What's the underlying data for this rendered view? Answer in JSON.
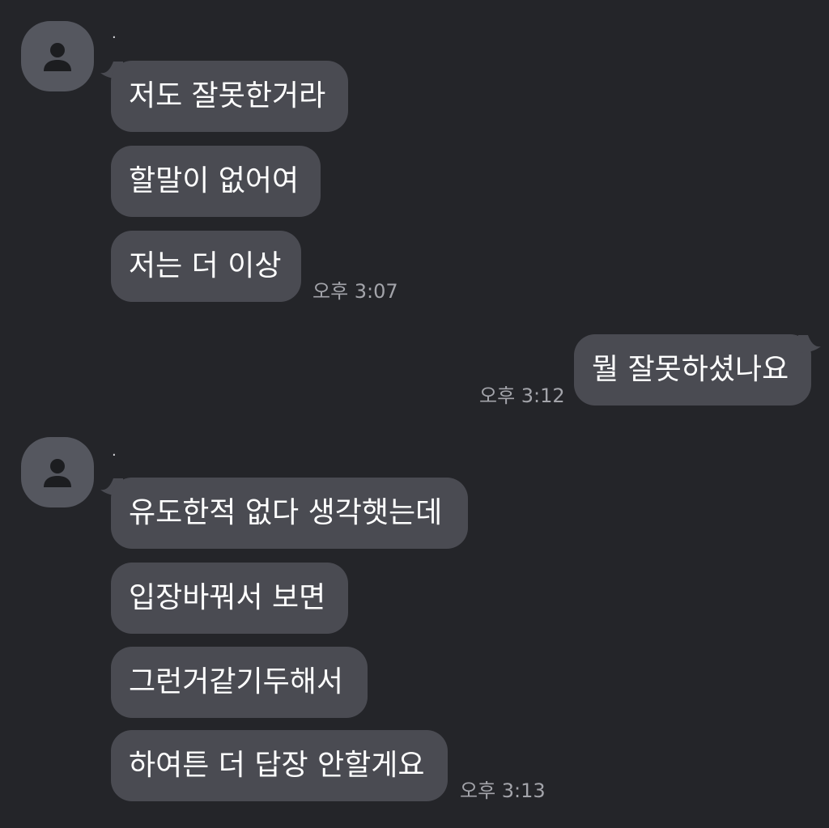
{
  "messages": {
    "group1": {
      "sender_name": "·",
      "avatar_icon": "person-icon",
      "bubbles": [
        "저도 잘못한거라",
        "할말이 없어여",
        "저는 더 이상"
      ],
      "time": "오후 3:07"
    },
    "outgoing": {
      "text": "뭘 잘못하셨나요",
      "time": "오후 3:12"
    },
    "group2": {
      "sender_name": "·",
      "avatar_icon": "person-icon",
      "bubbles": [
        "유도한적 없다 생각햇는데",
        "입장바꿔서 보면",
        "그런거같기두해서",
        "하여튼 더 답장 안할게요"
      ],
      "time": "오후 3:13"
    }
  },
  "colors": {
    "background": "#242529",
    "bubble": "#4a4b52",
    "avatar": "#55575f",
    "timestamp": "#a3a4aa"
  }
}
